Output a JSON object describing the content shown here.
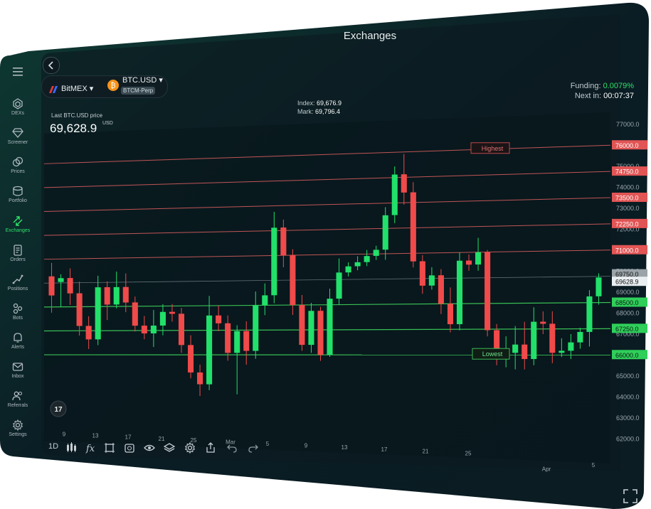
{
  "app": {
    "title": "Exchanges"
  },
  "sidebar": {
    "items": [
      {
        "label": "DEXs",
        "icon": "dex-icon"
      },
      {
        "label": "Screener",
        "icon": "diamond-icon"
      },
      {
        "label": "Prices",
        "icon": "coins-icon"
      },
      {
        "label": "Portfolio",
        "icon": "wallet-icon"
      },
      {
        "label": "Exchanges",
        "icon": "exchange-arrows-icon",
        "active": true
      },
      {
        "label": "Orders",
        "icon": "orders-icon"
      },
      {
        "label": "Positions",
        "icon": "positions-icon"
      },
      {
        "label": "Bots",
        "icon": "bots-icon"
      },
      {
        "label": "Alerts",
        "icon": "bell-icon"
      },
      {
        "label": "Inbox",
        "icon": "mail-icon"
      },
      {
        "label": "Referrals",
        "icon": "users-icon"
      },
      {
        "label": "Settings",
        "icon": "gear-icon"
      }
    ]
  },
  "header": {
    "exchange": "BitMEX ▾",
    "pair": "BTC.USD ▾",
    "pair_badge": "BTCM-Perp",
    "funding_label": "Funding: ",
    "funding_value": "0.0079%",
    "next_label": "Next in: ",
    "next_value": "00:07:37"
  },
  "ticker": {
    "last_label": "Last BTC.USD price",
    "last_price": "69,628.9",
    "unit": "USD",
    "index_label": "Index: ",
    "index_value": "69,676.9",
    "mark_label": "Mark: ",
    "mark_value": "69,796.4"
  },
  "toolbar": {
    "interval": "1D",
    "tools": [
      "candles-icon",
      "fx-icon",
      "crop-icon",
      "snapshot-icon",
      "eye-icon",
      "layers-icon",
      "gear-icon",
      "share-icon",
      "undo-icon",
      "redo-icon"
    ]
  },
  "chart_data": {
    "type": "candlestick",
    "y_ticks": [
      77000,
      76000,
      75000,
      74000,
      73000,
      72000,
      71000,
      70000,
      69000,
      68000,
      67000,
      66000,
      65000,
      64000,
      63000,
      62000
    ],
    "y_tick_labels": [
      "77000.0",
      "76000.0",
      "75000.0",
      "74000.0",
      "73000.0",
      "72000.0",
      "71000.0",
      "70000.0",
      "69000.0",
      "68000.0",
      "67000.0",
      "66000.0",
      "65000.0",
      "64000.0",
      "63000.0",
      "62000.0"
    ],
    "ylim": [
      61500,
      77500
    ],
    "x_labels": [
      "9",
      "13",
      "17",
      "21",
      "25",
      "Mar",
      "5",
      "9",
      "13",
      "17",
      "21",
      "25",
      "Apr",
      "5"
    ],
    "highest_label": "Highest",
    "lowest_label": "Lowest",
    "resistance_levels": [
      {
        "value": 76000,
        "label": "76000.0"
      },
      {
        "value": 74750,
        "label": "74750.0"
      },
      {
        "value": 73500,
        "label": "73500.0"
      },
      {
        "value": 72250,
        "label": "72250.0"
      },
      {
        "value": 71000,
        "label": "71000.0"
      }
    ],
    "support_levels": [
      {
        "value": 68500,
        "label": "68500.0"
      },
      {
        "value": 67250,
        "label": "67250.0"
      },
      {
        "value": 66000,
        "label": "66000.0"
      }
    ],
    "price_tags": [
      {
        "value": 69750,
        "label": "69750.0"
      },
      {
        "value": 69628.9,
        "label": "69628.9"
      }
    ],
    "colors": {
      "up": "#22e06a",
      "down": "#f04a4a",
      "resistance": "#e06060",
      "support": "#3fd05a"
    },
    "candles": [
      [
        70100,
        69100,
        70800,
        68200
      ],
      [
        69800,
        70000,
        70200,
        68500
      ],
      [
        70000,
        69200,
        70500,
        68600
      ],
      [
        69200,
        67500,
        69800,
        67000
      ],
      [
        67500,
        66800,
        68000,
        66300
      ],
      [
        66800,
        69500,
        70100,
        66500
      ],
      [
        69500,
        68600,
        69800,
        67800
      ],
      [
        68600,
        69500,
        70300,
        68400
      ],
      [
        69500,
        68700,
        70200,
        68200
      ],
      [
        68700,
        67500,
        69000,
        67200
      ],
      [
        67500,
        67100,
        68000,
        66800
      ],
      [
        67100,
        67500,
        68300,
        66400
      ],
      [
        67500,
        68200,
        68600,
        67000
      ],
      [
        68200,
        68100,
        68600,
        67700
      ],
      [
        68100,
        66500,
        68400,
        66100
      ],
      [
        66500,
        65100,
        67000,
        64800
      ],
      [
        65100,
        64500,
        65500,
        63900
      ],
      [
        64500,
        68000,
        69000,
        64200
      ],
      [
        68000,
        67600,
        68500,
        67200
      ],
      [
        67600,
        66100,
        68000,
        65700
      ],
      [
        66100,
        67200,
        67500,
        64000
      ],
      [
        67200,
        66200,
        67700,
        65500
      ],
      [
        66200,
        68500,
        69200,
        65800
      ],
      [
        68500,
        69000,
        69600,
        68000
      ],
      [
        69000,
        72400,
        73200,
        68600
      ],
      [
        72400,
        71000,
        72800,
        70400
      ],
      [
        71000,
        68500,
        71300,
        68000
      ],
      [
        68500,
        66500,
        69000,
        66200
      ],
      [
        66500,
        68200,
        68600,
        66100
      ],
      [
        68200,
        66000,
        68400,
        65700
      ],
      [
        66000,
        68800,
        69300,
        65900
      ],
      [
        68800,
        70100,
        70800,
        68500
      ],
      [
        70100,
        70400,
        70600,
        69900
      ],
      [
        70400,
        70600,
        70900,
        70200
      ],
      [
        70600,
        70900,
        71200,
        70400
      ],
      [
        70900,
        71200,
        71400,
        70700
      ],
      [
        71200,
        72900,
        73300,
        70700
      ],
      [
        72900,
        74900,
        75300,
        72500
      ],
      [
        74900,
        74000,
        75900,
        73400
      ],
      [
        74000,
        70600,
        74500,
        70300
      ],
      [
        70600,
        69400,
        70900,
        69000
      ],
      [
        69400,
        69900,
        70300,
        69200
      ],
      [
        69900,
        68500,
        70200,
        68000
      ],
      [
        68500,
        67500,
        69300,
        67100
      ],
      [
        67500,
        70600,
        71000,
        67200
      ],
      [
        70600,
        70400,
        70900,
        70100
      ],
      [
        70400,
        71000,
        71700,
        70100
      ],
      [
        71000,
        67200,
        71100,
        66900
      ],
      [
        67200,
        65900,
        67500,
        65500
      ],
      [
        65900,
        66100,
        66900,
        65400
      ],
      [
        66100,
        66500,
        67400,
        65300
      ],
      [
        66500,
        65800,
        67600,
        65300
      ],
      [
        65800,
        67600,
        68300,
        65500
      ],
      [
        67600,
        67500,
        68100,
        67000
      ],
      [
        67500,
        66100,
        68100,
        65600
      ],
      [
        66100,
        66200,
        66800,
        65900
      ],
      [
        66200,
        66600,
        67000,
        65800
      ],
      [
        66600,
        67100,
        67300,
        66300
      ],
      [
        67100,
        68800,
        69100,
        66400
      ],
      [
        68800,
        69700,
        69900,
        68400
      ]
    ]
  }
}
